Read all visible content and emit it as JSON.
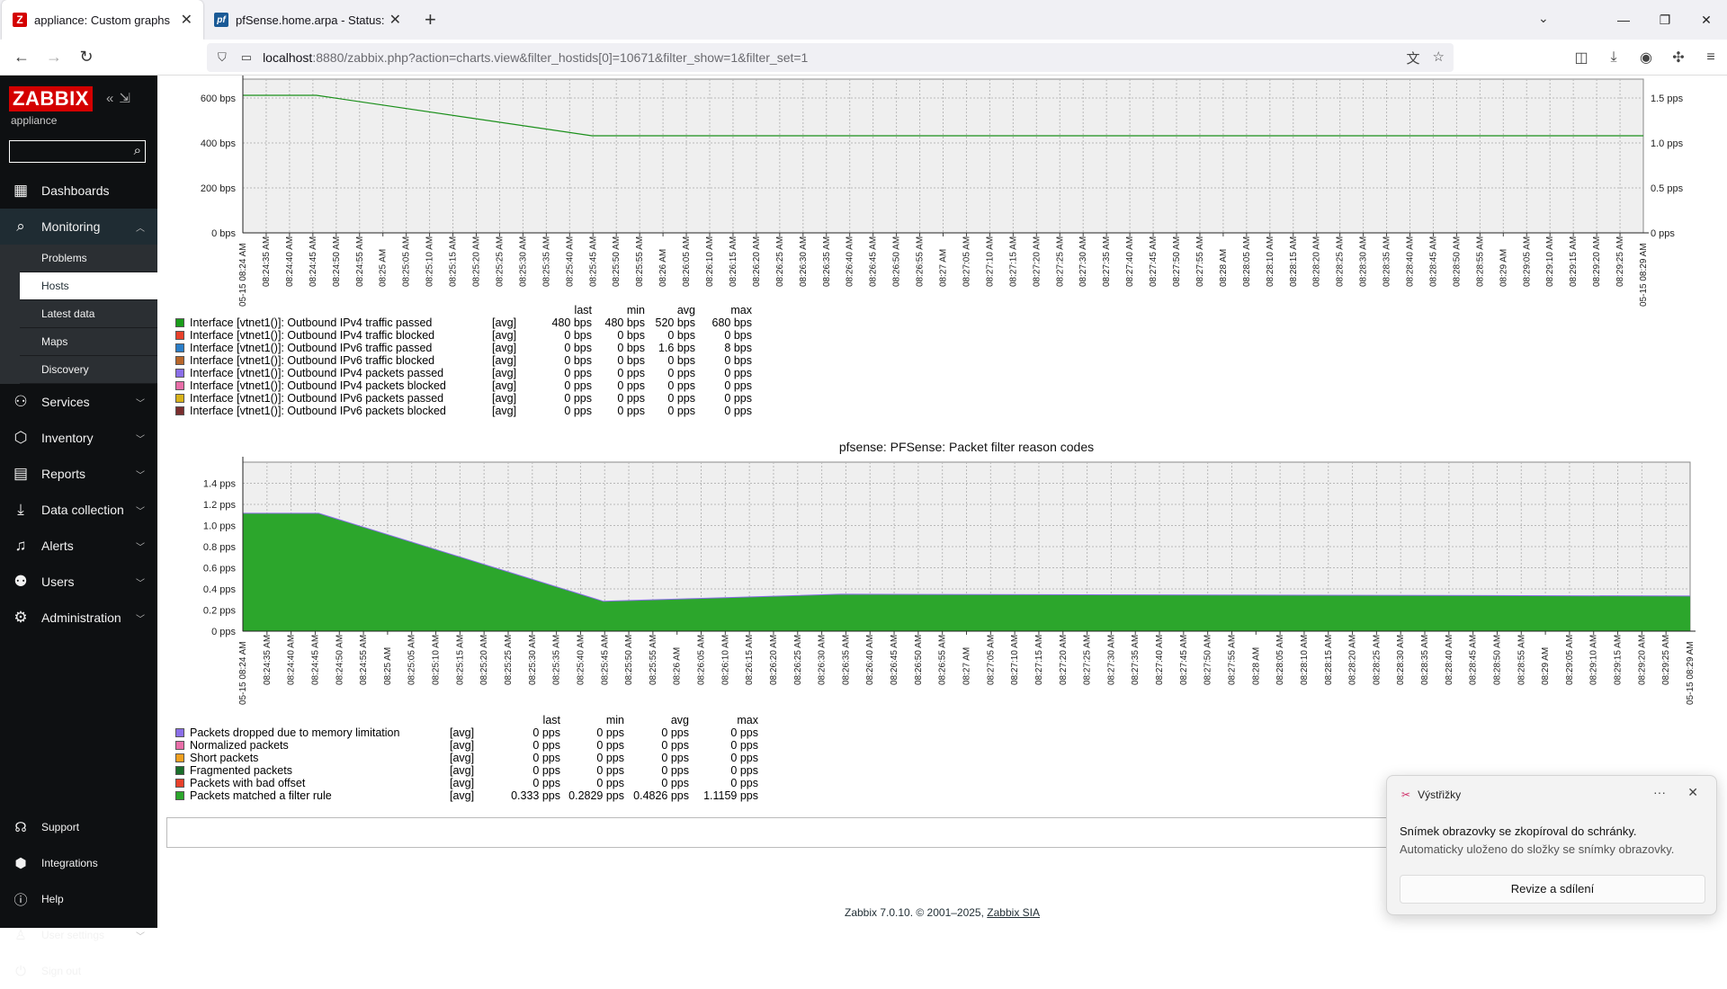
{
  "browser": {
    "tabs": [
      {
        "title": "appliance: Custom graphs",
        "favicon": "Z",
        "favicon_color": "#d40000",
        "active": true
      },
      {
        "title": "pfSense.home.arpa - Status: Da",
        "favicon": "pf",
        "favicon_color": "#1a5a96",
        "active": false
      }
    ],
    "url_host": "localhost",
    "url_rest": ":8880/zabbix.php?action=charts.view&filter_hostids[0]=10671&filter_show=1&filter_set=1"
  },
  "sidebar": {
    "logo": "ZABBIX",
    "instance": "appliance",
    "search_placeholder": "",
    "items": [
      {
        "label": "Dashboards",
        "icon": "dashboard-icon"
      },
      {
        "label": "Monitoring",
        "icon": "monitoring-icon",
        "open": true
      },
      {
        "label": "Services",
        "icon": "services-icon"
      },
      {
        "label": "Inventory",
        "icon": "inventory-icon"
      },
      {
        "label": "Reports",
        "icon": "reports-icon"
      },
      {
        "label": "Data collection",
        "icon": "data-collection-icon"
      },
      {
        "label": "Alerts",
        "icon": "alerts-icon"
      },
      {
        "label": "Users",
        "icon": "users-icon"
      },
      {
        "label": "Administration",
        "icon": "administration-icon"
      }
    ],
    "monitoring_sub": [
      "Problems",
      "Hosts",
      "Latest data",
      "Maps",
      "Discovery"
    ],
    "bottom": [
      "Support",
      "Integrations",
      "Help",
      "User settings",
      "Sign out"
    ]
  },
  "time_labels": [
    "08:24:35 AM",
    "08:24:40 AM",
    "08:24:45 AM",
    "08:24:50 AM",
    "08:24:55 AM",
    "08:25 AM",
    "08:25:05 AM",
    "08:25:10 AM",
    "08:25:15 AM",
    "08:25:20 AM",
    "08:25:25 AM",
    "08:25:30 AM",
    "08:25:35 AM",
    "08:25:40 AM",
    "08:25:45 AM",
    "08:25:50 AM",
    "08:25:55 AM",
    "08:26 AM",
    "08:26:05 AM",
    "08:26:10 AM",
    "08:26:15 AM",
    "08:26:20 AM",
    "08:26:25 AM",
    "08:26:30 AM",
    "08:26:35 AM",
    "08:26:40 AM",
    "08:26:45 AM",
    "08:26:50 AM",
    "08:26:55 AM",
    "08:27 AM",
    "08:27:05 AM",
    "08:27:10 AM",
    "08:27:15 AM",
    "08:27:20 AM",
    "08:27:25 AM",
    "08:27:30 AM",
    "08:27:35 AM",
    "08:27:40 AM",
    "08:27:45 AM",
    "08:27:50 AM",
    "08:27:55 AM",
    "08:28 AM",
    "08:28:05 AM",
    "08:28:10 AM",
    "08:28:15 AM",
    "08:28:20 AM",
    "08:28:25 AM",
    "08:28:30 AM",
    "08:28:35 AM",
    "08:28:40 AM",
    "08:28:45 AM",
    "08:28:50 AM",
    "08:28:55 AM",
    "08:29 AM",
    "08:29:05 AM",
    "08:29:10 AM",
    "08:29:15 AM",
    "08:29:20 AM",
    "08:29:25 AM"
  ],
  "chart_data": [
    {
      "type": "line",
      "title": "",
      "start_label": "05-15 08:24 AM",
      "end_label": "05-15 08:29 AM",
      "y_left_ticks": [
        "600 bps",
        "400 bps",
        "200 bps",
        "0 bps"
      ],
      "y_right_ticks": [
        "1.5 pps",
        "1.0 pps",
        "0.5 pps",
        "0 pps"
      ],
      "series": [
        {
          "name": "Interface [vtnet1()]: Outbound IPv4 traffic passed",
          "color": "#1a8f1a",
          "x": [
            "08:24:24",
            "08:24:40",
            "08:25:40",
            "08:29:29"
          ],
          "values": [
            680,
            680,
            480,
            480
          ]
        }
      ],
      "legend_header": [
        "last",
        "min",
        "avg",
        "max"
      ],
      "legend": [
        {
          "name": "Interface [vtnet1()]: Outbound IPv4 traffic passed",
          "color": "#1a9c1a",
          "fn": "[avg]",
          "last": "480 bps",
          "min": "480 bps",
          "avg": "520 bps",
          "max": "680 bps"
        },
        {
          "name": "Interface [vtnet1()]: Outbound IPv4 traffic blocked",
          "color": "#e8402a",
          "fn": "[avg]",
          "last": "0 bps",
          "min": "0 bps",
          "avg": "0 bps",
          "max": "0 bps"
        },
        {
          "name": "Interface [vtnet1()]: Outbound IPv6 traffic passed",
          "color": "#2a7ec8",
          "fn": "[avg]",
          "last": "0 bps",
          "min": "0 bps",
          "avg": "1.6 bps",
          "max": "8 bps"
        },
        {
          "name": "Interface [vtnet1()]: Outbound IPv6 traffic blocked",
          "color": "#b8662a",
          "fn": "[avg]",
          "last": "0 bps",
          "min": "0 bps",
          "avg": "0 bps",
          "max": "0 bps"
        },
        {
          "name": "Interface [vtnet1()]: Outbound IPv4 packets passed",
          "color": "#8a6ee8",
          "fn": "[avg]",
          "last": "0 pps",
          "min": "0 pps",
          "avg": "0 pps",
          "max": "0 pps"
        },
        {
          "name": "Interface [vtnet1()]: Outbound IPv4 packets blocked",
          "color": "#e86ea8",
          "fn": "[avg]",
          "last": "0 pps",
          "min": "0 pps",
          "avg": "0 pps",
          "max": "0 pps"
        },
        {
          "name": "Interface [vtnet1()]: Outbound IPv6 packets passed",
          "color": "#d8b21a",
          "fn": "[avg]",
          "last": "0 pps",
          "min": "0 pps",
          "avg": "0 pps",
          "max": "0 pps"
        },
        {
          "name": "Interface [vtnet1()]: Outbound IPv6 packets blocked",
          "color": "#7a2e2e",
          "fn": "[avg]",
          "last": "0 pps",
          "min": "0 pps",
          "avg": "0 pps",
          "max": "0 pps"
        }
      ]
    },
    {
      "type": "area",
      "title": "pfsense: PFSense: Packet filter reason codes",
      "start_label": "05-15 08:24 AM",
      "end_label": "05-15 08:29 AM",
      "y_ticks": [
        "1.4 pps",
        "1.2 pps",
        "1.0 pps",
        "0.8 pps",
        "0.6 pps",
        "0.4 pps",
        "0.2 pps",
        "0 pps"
      ],
      "ylim": [
        0,
        1.4
      ],
      "series": [
        {
          "name": "Packets matched a filter rule",
          "color": "#2ca62c",
          "x": [
            "08:24:24",
            "08:24:40",
            "08:25:40",
            "08:26:00",
            "08:26:30",
            "08:29:29"
          ],
          "values": [
            1.1159,
            1.1159,
            0.2829,
            0.31,
            0.35,
            0.333
          ]
        }
      ],
      "legend_header": [
        "last",
        "min",
        "avg",
        "max"
      ],
      "legend": [
        {
          "name": "Packets dropped due to memory limitation",
          "color": "#8a6ee8",
          "fn": "[avg]",
          "last": "0 pps",
          "min": "0 pps",
          "avg": "0 pps",
          "max": "0 pps"
        },
        {
          "name": "Normalized packets",
          "color": "#e86ea8",
          "fn": "[avg]",
          "last": "0 pps",
          "min": "0 pps",
          "avg": "0 pps",
          "max": "0 pps"
        },
        {
          "name": "Short packets",
          "color": "#f0a020",
          "fn": "[avg]",
          "last": "0 pps",
          "min": "0 pps",
          "avg": "0 pps",
          "max": "0 pps"
        },
        {
          "name": "Fragmented packets",
          "color": "#1a6e2a",
          "fn": "[avg]",
          "last": "0 pps",
          "min": "0 pps",
          "avg": "0 pps",
          "max": "0 pps"
        },
        {
          "name": "Packets with bad offset",
          "color": "#e8402a",
          "fn": "[avg]",
          "last": "0 pps",
          "min": "0 pps",
          "avg": "0 pps",
          "max": "0 pps"
        },
        {
          "name": "Packets matched a filter rule",
          "color": "#2ca62c",
          "fn": "[avg]",
          "last": "0.333 pps",
          "min": "0.2829 pps",
          "avg": "0.4826 pps",
          "max": "1.1159 pps"
        }
      ]
    }
  ],
  "footer": {
    "text": "Zabbix 7.0.10. © 2001–2025,",
    "link": "Zabbix SIA"
  },
  "toast": {
    "app": "Výstřižky",
    "line1": "Snímek obrazovky se zkopíroval do schránky.",
    "line2": "Automaticky uloženo do složky se snímky obrazovky.",
    "button": "Revize a sdílení"
  }
}
